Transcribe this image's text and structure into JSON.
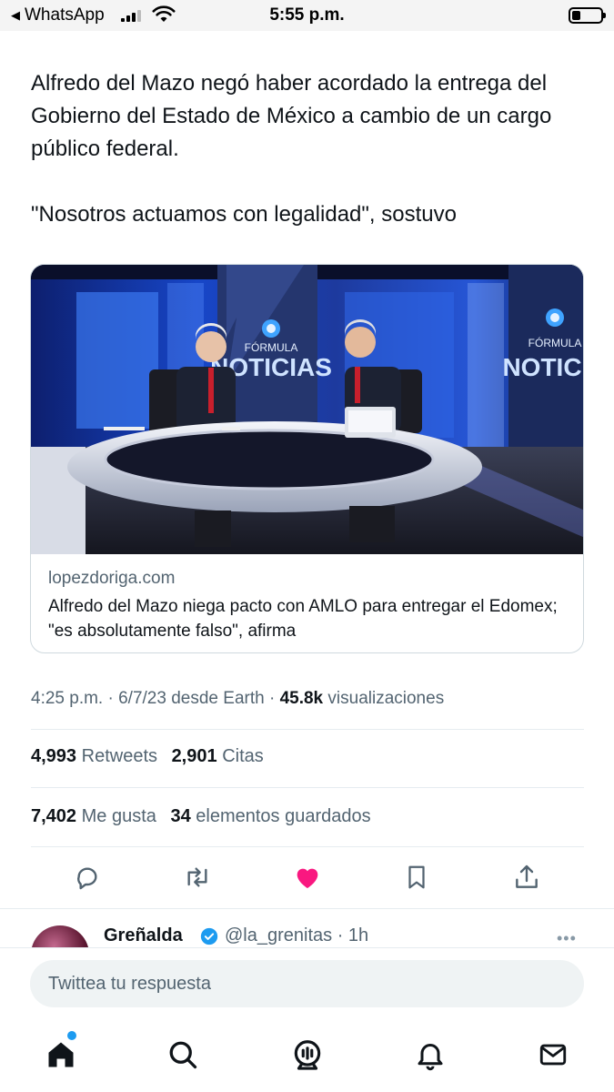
{
  "status_bar": {
    "back_label": "WhatsApp",
    "time": "5:55 p.m.",
    "battery_fraction": 0.25
  },
  "tweet": {
    "paragraphs": [
      "Alfredo del Mazo negó haber acordado la entrega del Gobierno del Estado de México a cambio de un cargo público federal.",
      "\"Nosotros actuamos con legalidad\", sostuvo"
    ]
  },
  "card": {
    "image_logo_text_left": "FÓRMULA",
    "image_logo_brand_left": "NOTICIAS",
    "image_logo_text_right": "FÓRMULA",
    "image_logo_brand_right": "NOTICIA",
    "domain": "lopezdoriga.com",
    "title": "Alfredo del Mazo niega pacto con AMLO para entregar el Edomex; \"es absolutamente falso\", afirma"
  },
  "meta": {
    "time": "4:25 p.m.",
    "date": "6/7/23",
    "source": "desde Earth",
    "views_count": "45.8k",
    "views_label": "visualizaciones"
  },
  "stats": {
    "retweets_count": "4,993",
    "retweets_label": "Retweets",
    "quotes_count": "2,901",
    "quotes_label": "Citas",
    "likes_count": "7,402",
    "likes_label": "Me gusta",
    "bookmarks_count": "34",
    "bookmarks_label": "elementos guardados"
  },
  "actions": {
    "icons": [
      "reply-icon",
      "retweet-icon",
      "like-icon",
      "bookmark-icon",
      "share-icon"
    ],
    "like_color": "#f91880",
    "icon_color": "#536471"
  },
  "reply": {
    "name": "Greñalda",
    "handle": "@la_grenitas",
    "time": "· 1h",
    "more": "•••",
    "verified_color": "#1d9bf0"
  },
  "compose": {
    "placeholder": "Twittea tu respuesta"
  },
  "nav": {
    "items": [
      "home-icon",
      "search-icon",
      "spaces-icon",
      "notifications-icon",
      "messages-icon"
    ],
    "unread_dot_color": "#1d9bf0"
  }
}
